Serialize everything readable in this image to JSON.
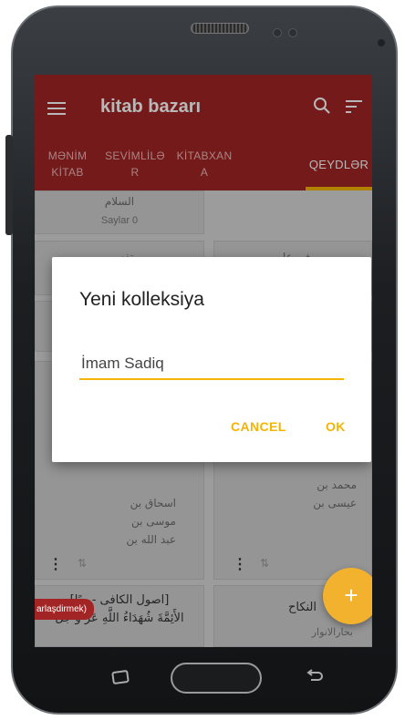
{
  "app": {
    "title": "kitab bazarı"
  },
  "tabs": [
    {
      "label": "MƏNİM KİTAB",
      "active": false
    },
    {
      "label": "SEVİMLİLƏ R",
      "active": false
    },
    {
      "label": "KİTABXAN A",
      "active": false
    },
    {
      "label": "QEYDLƏR",
      "active": true
    }
  ],
  "background_cards": {
    "card1_title": "السلام",
    "card1_count": "Saylar 0",
    "card2_partial": "تفسير",
    "card3_partial": "في علم",
    "card4_lines": [
      "اسحاق بن",
      "موسى بن",
      "عبد الله بن"
    ],
    "card5_lines": [
      "محمد بن",
      "عيسى بن"
    ],
    "card6_title": "[اصول الكافى - مِبًا]",
    "card6_sub": "الأَئِمَّةَ شُهَدَاءُ اللَّهِ عَزَّ وَ جَلَّ",
    "card7_title": "النكاح",
    "card7_sub": "بحارالانوار"
  },
  "dialog": {
    "title": "Yeni kolleksiya",
    "input_value": "İmam Sadiq",
    "cancel_label": "CANCEL",
    "ok_label": "OK"
  },
  "fab": {
    "icon": "plus-icon",
    "label": "+"
  },
  "toast": {
    "text": "arlaşdirmek)"
  },
  "colors": {
    "app_bar": "#a32424",
    "accent": "#f4b400",
    "fab": "#f2b22e"
  }
}
